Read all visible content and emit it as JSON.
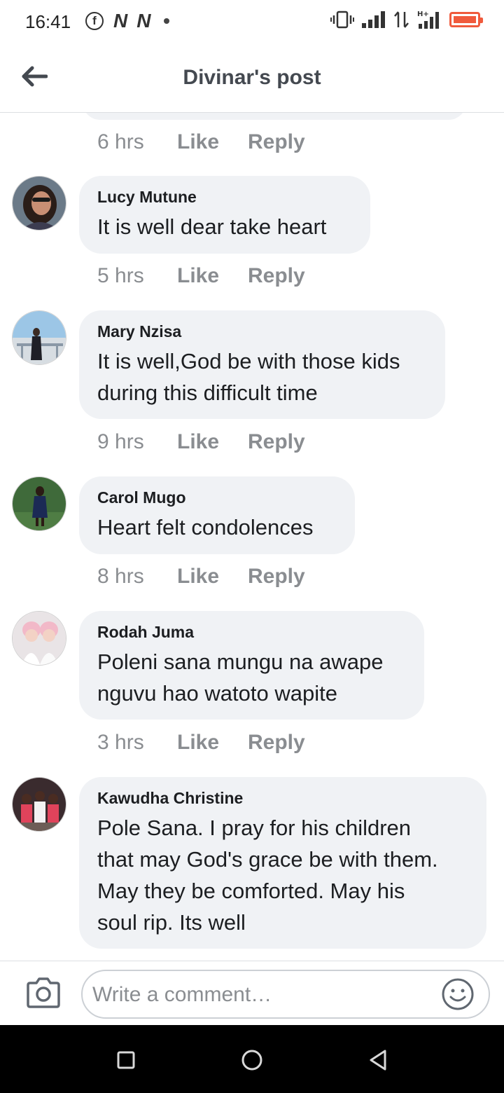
{
  "status_bar": {
    "time": "16:41",
    "notif_icons": [
      "facebook-icon",
      "n-app-icon",
      "n-app-icon",
      "dot-icon"
    ],
    "n_glyph": "N",
    "fb_glyph": "f",
    "right_icons": [
      "vibrate-icon",
      "signal-icon",
      "data-arrows-icon",
      "hplus-signal-icon",
      "battery-icon"
    ],
    "battery_color": "#f05a3c"
  },
  "header": {
    "title": "Divinar's post",
    "back_icon": "arrow-left-icon"
  },
  "previous_comment_actions": {
    "time": "6 hrs",
    "like": "Like",
    "reply": "Reply"
  },
  "comments": [
    {
      "name": "Lucy Mutune",
      "lines": [
        "It is well dear take heart"
      ],
      "time": "5 hrs",
      "like": "Like",
      "reply": "Reply"
    },
    {
      "name": "Mary Nzisa",
      "lines": [
        "It is well,God be with those kids",
        "during this difficult time"
      ],
      "time": "9 hrs",
      "like": "Like",
      "reply": "Reply"
    },
    {
      "name": "Carol Mugo",
      "lines": [
        "Heart felt condolences"
      ],
      "time": "8 hrs",
      "like": "Like",
      "reply": "Reply"
    },
    {
      "name": "Rodah Juma",
      "lines": [
        "Poleni sana mungu na awape",
        "nguvu hao watoto wapite"
      ],
      "time": "3 hrs",
      "like": "Like",
      "reply": "Reply"
    },
    {
      "name": "Kawudha Christine",
      "lines": [
        "Pole Sana. I pray for his children",
        "that may God's grace be with them.",
        "May they be comforted. May his",
        "soul rip. Its well"
      ]
    }
  ],
  "comment_bar": {
    "placeholder": "Write a comment…",
    "camera_icon": "camera-icon",
    "emoji_icon": "emoji-icon"
  },
  "nav_bar": {
    "buttons": [
      "recents-square-icon",
      "home-circle-icon",
      "back-triangle-icon"
    ]
  },
  "colors": {
    "bubble": "#f0f2f5",
    "meta_text": "#8a8d91",
    "title": "#444950"
  }
}
